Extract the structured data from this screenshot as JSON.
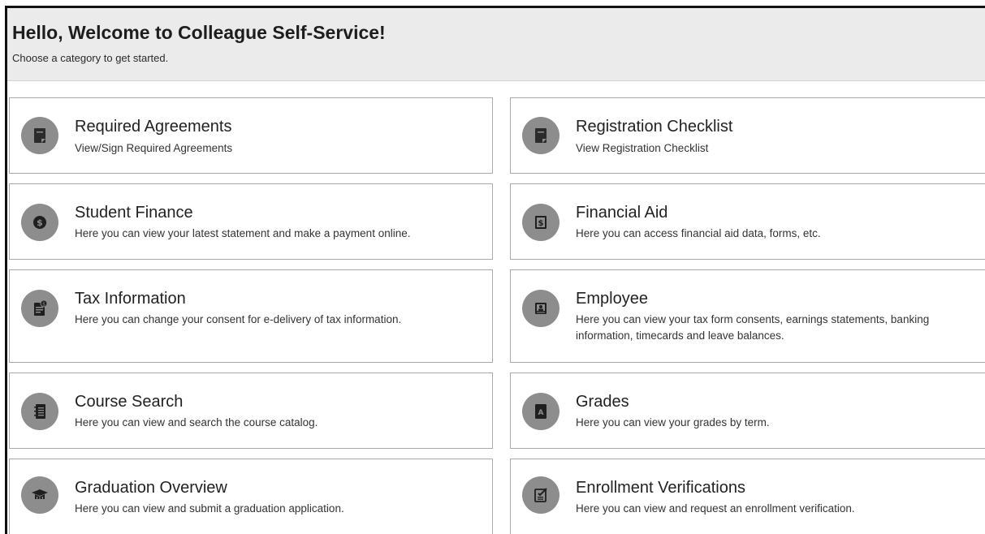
{
  "header": {
    "welcome": "Hello, Welcome to Colleague Self-Service!",
    "subtitle": "Choose a category to get started."
  },
  "cards": [
    {
      "title": "Required Agreements",
      "description": "View/Sign Required Agreements",
      "icon": "document-icon"
    },
    {
      "title": "Registration Checklist",
      "description": "View Registration Checklist",
      "icon": "document-icon"
    },
    {
      "title": "Student Finance",
      "description": "Here you can view your latest statement and make a payment online.",
      "icon": "coin-icon"
    },
    {
      "title": "Financial Aid",
      "description": "Here you can access financial aid data, forms, etc.",
      "icon": "money-bill-icon"
    },
    {
      "title": "Tax Information",
      "description": "Here you can change your consent for e-delivery of tax information.",
      "icon": "tax-document-icon"
    },
    {
      "title": "Employee",
      "description": "Here you can view your tax form consents, earnings statements, banking information, timecards and leave balances.",
      "icon": "id-badge-icon"
    },
    {
      "title": "Course Search",
      "description": "Here you can view and search the course catalog.",
      "icon": "notebook-icon"
    },
    {
      "title": "Grades",
      "description": "Here you can view your grades by term.",
      "icon": "grade-book-icon"
    },
    {
      "title": "Graduation Overview",
      "description": "Here you can view and submit a graduation application.",
      "icon": "graduation-cap-icon"
    },
    {
      "title": "Enrollment Verifications",
      "description": "Here you can view and request an enrollment verification.",
      "icon": "checklist-icon"
    }
  ],
  "colors": {
    "header_bg": "#ebebeb",
    "icon_bg": "#8d8d8d",
    "card_border": "#a9a9a9"
  }
}
